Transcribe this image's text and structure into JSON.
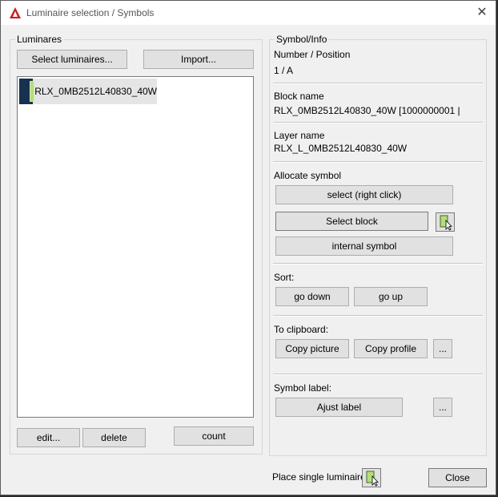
{
  "window": {
    "title": "Luminaire selection / Symbols",
    "close_glyph": "✕"
  },
  "luminaires": {
    "group_title": "Luminares",
    "select_button": "Select luminaires...",
    "import_button": "Import...",
    "items": [
      {
        "label": "RLX_0MB2512L40830_40W",
        "icon": "luminaire-icon"
      }
    ],
    "edit_button": "edit...",
    "delete_button": "delete",
    "count_button": "count"
  },
  "symbol_info": {
    "group_title": "Symbol/Info",
    "number_label": "Number / Position",
    "number_value": "1 / A",
    "block_name_label": "Block name",
    "block_name_value": "RLX_0MB2512L40830_40W [1000000001 |",
    "layer_name_label": "Layer name",
    "layer_name_value": "RLX_L_0MB2512L40830_40W",
    "allocate_label": "Allocate symbol",
    "select_right_click": "select (right click)",
    "select_block": "Select block",
    "internal_symbol": "internal symbol",
    "sort_label": "Sort:",
    "go_down": "go down",
    "go_up": "go up",
    "clipboard_label": "To clipboard:",
    "copy_picture": "Copy picture",
    "copy_profile": "Copy profile",
    "ellipsis": "...",
    "symbol_label_label": "Symbol label:",
    "ajust_label": "Ajust label"
  },
  "footer": {
    "place_single_label": "Place single luminaire",
    "close_button": "Close"
  },
  "colors": {
    "accent_red": "#c8201e",
    "luminaire_blue": "#17324f",
    "luminaire_green": "#b5dd7a"
  }
}
